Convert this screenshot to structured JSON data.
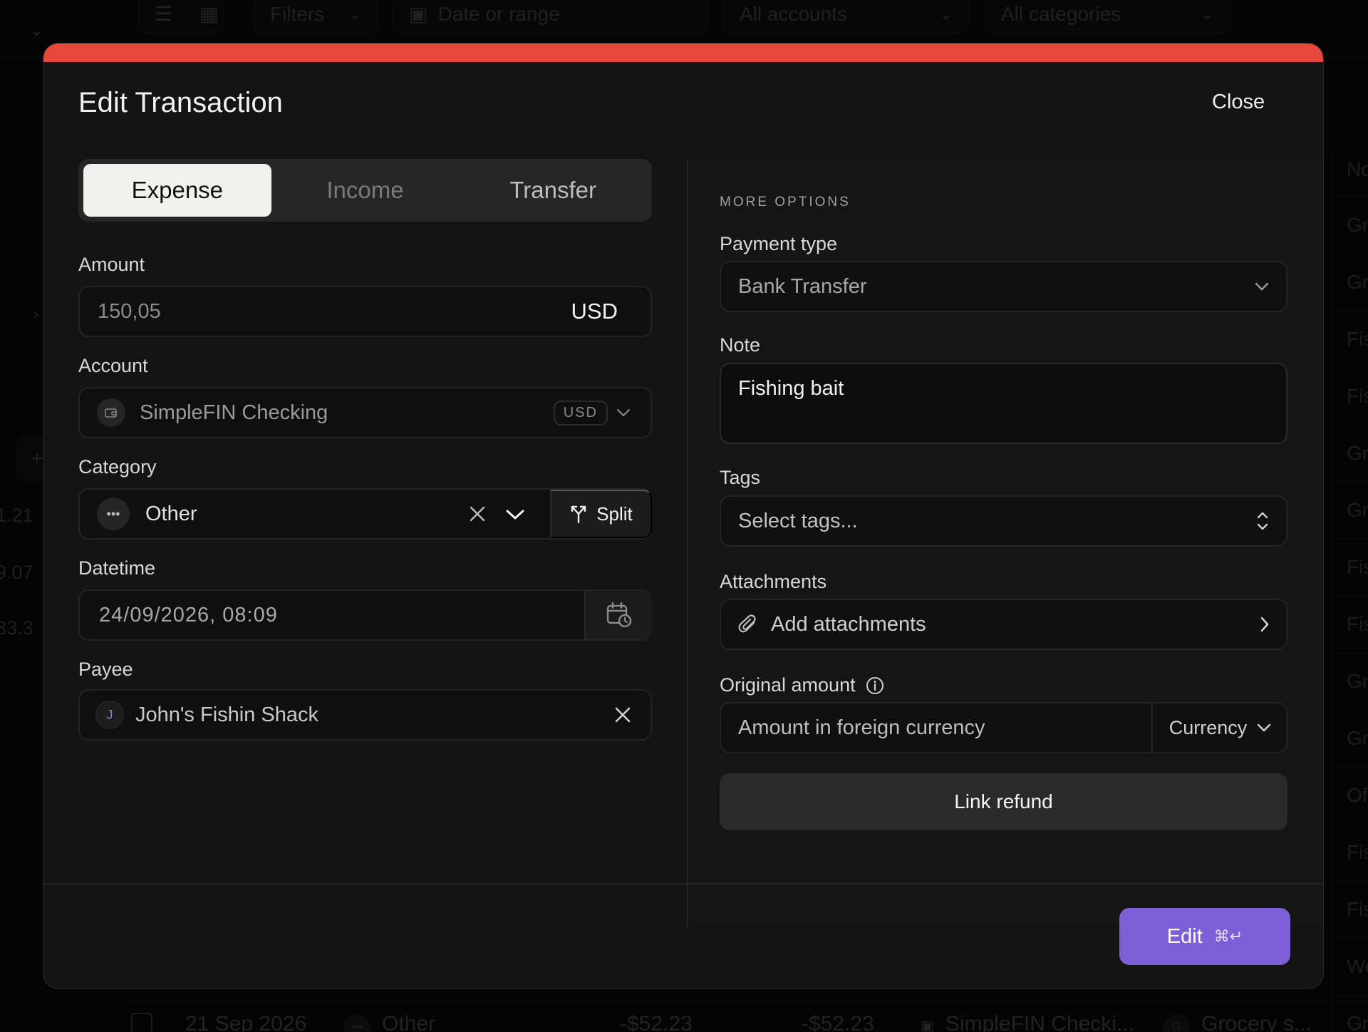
{
  "background": {
    "topbar": {
      "filters_label": "Filters",
      "date_placeholder": "Date or range",
      "accounts_label": "All accounts",
      "categories_label": "All categories"
    },
    "left_values": [
      "1.21",
      "9.07",
      "33.3"
    ],
    "right_column": {
      "header": "No",
      "cells": [
        "Gr",
        "Gr",
        "Fis",
        "Fis",
        "Gr",
        "Gr",
        "Fis",
        "Fis",
        "Gr",
        "Gr",
        "Of",
        "Fis",
        "Fis",
        "We",
        "Gr"
      ]
    },
    "bottom_row": {
      "date": "21 Sep 2026",
      "category": "Other",
      "amount1": "-$52.23",
      "amount2": "-$52.23",
      "account": "SimpleFIN Checki...",
      "payee_initial": "G",
      "payee": "Grocery s..."
    }
  },
  "modal": {
    "title": "Edit Transaction",
    "close_label": "Close",
    "accent_color": "#e8473c",
    "tabs": [
      {
        "label": "Expense",
        "active": true
      },
      {
        "label": "Income",
        "active": false
      },
      {
        "label": "Transfer",
        "active": false
      }
    ],
    "amount": {
      "label": "Amount",
      "value": "150,05",
      "currency": "USD"
    },
    "account": {
      "label": "Account",
      "value": "SimpleFIN Checking",
      "currency_badge": "USD",
      "icon": "wallet-icon"
    },
    "category": {
      "label": "Category",
      "value": "Other",
      "split_label": "Split",
      "icon": "more-dots-icon"
    },
    "datetime": {
      "label": "Datetime",
      "value": "24/09/2026, 08:09",
      "icon": "calendar-clock-icon"
    },
    "payee": {
      "label": "Payee",
      "initial": "J",
      "value": "John's Fishin Shack"
    },
    "more_options": {
      "heading": "MORE OPTIONS",
      "payment_type": {
        "label": "Payment type",
        "value": "Bank Transfer"
      },
      "note": {
        "label": "Note",
        "value": "Fishing bait"
      },
      "tags": {
        "label": "Tags",
        "placeholder": "Select tags..."
      },
      "attachments": {
        "label": "Attachments",
        "action": "Add attachments",
        "icon": "paperclip-icon"
      },
      "original_amount": {
        "label": "Original amount",
        "placeholder": "Amount in foreign currency",
        "currency_label": "Currency",
        "icon": "info-icon"
      },
      "link_refund_label": "Link refund"
    },
    "submit": {
      "label": "Edit",
      "shortcut": "⌘↵",
      "color": "#7c5fd6"
    }
  }
}
